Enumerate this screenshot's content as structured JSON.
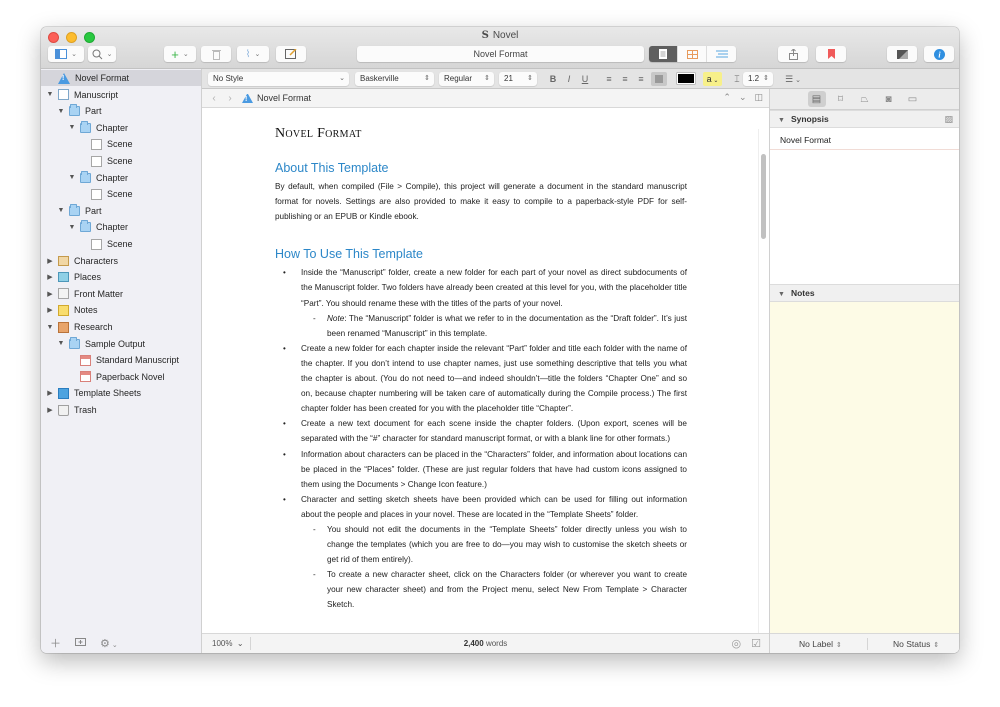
{
  "window": {
    "title": "Novel",
    "app_icon": "S"
  },
  "toolbar": {
    "document_title": "Novel Format",
    "accent_colors": {
      "add": "#3cb64a",
      "bookmark": "#f05a5a",
      "info": "#2f8fe0",
      "grid_view": "#e89a5a",
      "outline_view": "#5aa7e0"
    }
  },
  "formatbar": {
    "style": "No Style",
    "font": "Baskerville",
    "weight": "Regular",
    "size": "21",
    "bold": "B",
    "italic": "I",
    "underline": "U",
    "highlight": "a",
    "line_spacing": "1.2"
  },
  "binder": {
    "items": [
      {
        "label": "Novel Format",
        "icon": "warning-icon",
        "depth": 0,
        "disclosure": "",
        "selected": true
      },
      {
        "label": "Manuscript",
        "icon": "manuscript-icon",
        "depth": 0,
        "disclosure": "open"
      },
      {
        "label": "Part",
        "icon": "folder-icon",
        "depth": 1,
        "disclosure": "open"
      },
      {
        "label": "Chapter",
        "icon": "folder-icon",
        "depth": 2,
        "disclosure": "open"
      },
      {
        "label": "Scene",
        "icon": "doc-icon",
        "depth": 3,
        "disclosure": ""
      },
      {
        "label": "Scene",
        "icon": "doc-icon",
        "depth": 3,
        "disclosure": ""
      },
      {
        "label": "Chapter",
        "icon": "folder-icon",
        "depth": 2,
        "disclosure": "open"
      },
      {
        "label": "Scene",
        "icon": "doc-icon",
        "depth": 3,
        "disclosure": ""
      },
      {
        "label": "Part",
        "icon": "folder-icon",
        "depth": 1,
        "disclosure": "open"
      },
      {
        "label": "Chapter",
        "icon": "folder-icon",
        "depth": 2,
        "disclosure": "open"
      },
      {
        "label": "Scene",
        "icon": "doc-icon",
        "depth": 3,
        "disclosure": ""
      },
      {
        "label": "Characters",
        "icon": "characters-icon",
        "depth": 0,
        "disclosure": "closed"
      },
      {
        "label": "Places",
        "icon": "places-icon",
        "depth": 0,
        "disclosure": "closed"
      },
      {
        "label": "Front Matter",
        "icon": "frontmatter-icon",
        "depth": 0,
        "disclosure": "closed"
      },
      {
        "label": "Notes",
        "icon": "notes-icon",
        "depth": 0,
        "disclosure": "closed"
      },
      {
        "label": "Research",
        "icon": "research-icon",
        "depth": 0,
        "disclosure": "open"
      },
      {
        "label": "Sample Output",
        "icon": "folder-icon",
        "depth": 1,
        "disclosure": "open"
      },
      {
        "label": "Standard Manuscript",
        "icon": "pdf-icon",
        "depth": 2,
        "disclosure": ""
      },
      {
        "label": "Paperback Novel",
        "icon": "pdf-icon",
        "depth": 2,
        "disclosure": ""
      },
      {
        "label": "Template Sheets",
        "icon": "sheets-icon",
        "depth": 0,
        "disclosure": "closed"
      },
      {
        "label": "Trash",
        "icon": "trash-icon",
        "depth": 0,
        "disclosure": "closed"
      }
    ]
  },
  "editor": {
    "header_title": "Novel Format",
    "doc_title": "Novel Format",
    "sections": [
      {
        "heading": "About This Template",
        "paragraph": "By default, when compiled (File > Compile), this project will generate a document in the standard manuscript format for novels. Settings are also provided to make it easy to compile to a paperback-style PDF for self-publishing or an EPUB or Kindle ebook."
      },
      {
        "heading": "How To Use This Template",
        "bullets": [
          {
            "level": 1,
            "text": "Inside the “Manuscript” folder, create a new folder for each part of your novel as direct subdocuments of the Manuscript folder. Two  folders have already been created at this level for you, with the placeholder title “Part”. You should rename these with the titles of the parts of your novel."
          },
          {
            "level": 2,
            "lead": "Note",
            "text": ": The “Manuscript” folder is what we refer to in the documentation as the “Draft folder”. It’s just been renamed “Manuscript” in this template."
          },
          {
            "level": 1,
            "text": "Create a new folder for each chapter inside the relevant “Part” folder and title each folder with the name of the chapter. If you don’t intend to use chapter names, just use something descriptive that tells you what the chapter is about. (You do not need to—and indeed shouldn’t—title the folders “Chapter One” and so on, because chapter numbering will be taken care of automatically during the Compile process.) The first chapter folder has been created for you with the placeholder title “Chapter”."
          },
          {
            "level": 1,
            "text": "Create a new text document for each scene inside the chapter folders. (Upon export, scenes will be separated with the “#” character for standard manuscript format, or with a blank line for other formats.)"
          },
          {
            "level": 1,
            "text": "Information about characters can be placed in the “Characters” folder, and information about locations can be placed in the “Places” folder. (These are just regular folders that have had custom icons assigned to them using the Documents > Change Icon feature.)"
          },
          {
            "level": 1,
            "text": "Character and setting sketch sheets have been provided which can be used for filling out information about the people and places in your novel. These are located in the “Template Sheets” folder."
          },
          {
            "level": 2,
            "text": "You should not edit the documents in the “Template Sheets” folder directly unless you wish to change the templates (which you are free to do—you may wish to customise the sketch sheets or get rid of them entirely)."
          },
          {
            "level": 2,
            "text": "To create a new character sheet, click on the Characters folder (or wherever you want to create your new character sheet) and from the Project menu, select New From Template > Character Sketch."
          }
        ]
      }
    ],
    "footer": {
      "zoom": "100%",
      "word_count": "2,400",
      "word_label": "words"
    }
  },
  "inspector": {
    "synopsis_label": "Synopsis",
    "synopsis_title": "Novel Format",
    "notes_label": "Notes",
    "label_value": "No Label",
    "status_value": "No Status"
  }
}
